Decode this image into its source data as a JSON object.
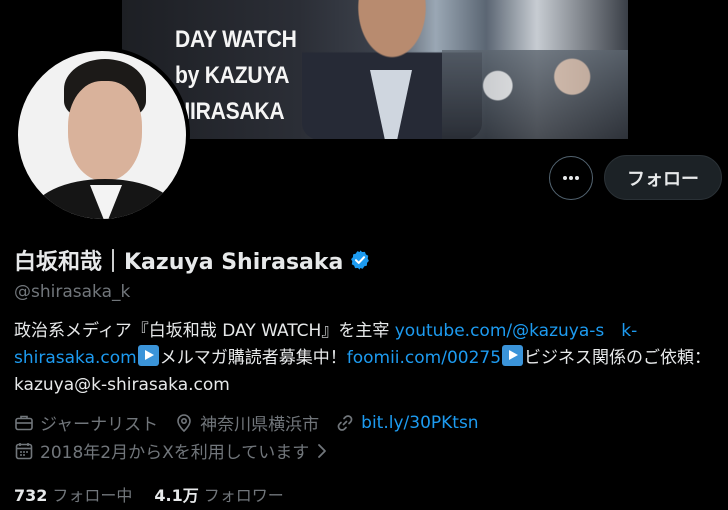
{
  "banner": {
    "line1": "DAY WATCH",
    "line2": "by KAZUYA",
    "line3": "HIRASAKA"
  },
  "actions": {
    "follow_label": "フォロー"
  },
  "profile": {
    "display_name": "白坂和哉｜Kazuya Shirasaka",
    "handle": "@shirasaka_k",
    "bio": {
      "text1": "政治系メディア『白坂和哉 DAY WATCH』を主宰 ",
      "link1": "youtube.com/@kazuya-s",
      "gap": "　",
      "link2": "k-shirasaka.com",
      "text2": "メルマガ購読者募集中！",
      "link3": "foomii.com/00275",
      "text3": "ビジネス関係のご依頼： kazuya@k-shirasaka.com"
    },
    "occupation": "ジャーナリスト",
    "location": "神奈川県横浜市",
    "website": "bit.ly/30PKtsn",
    "joined": "2018年2月からXを利用しています"
  },
  "stats": {
    "following_count": "732",
    "following_label": "フォロー中",
    "followers_count": "4.1万",
    "followers_label": "フォロワー"
  },
  "colors": {
    "background": "#000000",
    "text": "#e7e9ea",
    "muted": "#71767b",
    "link": "#1d9bf0",
    "verified": "#1d9bf0"
  }
}
